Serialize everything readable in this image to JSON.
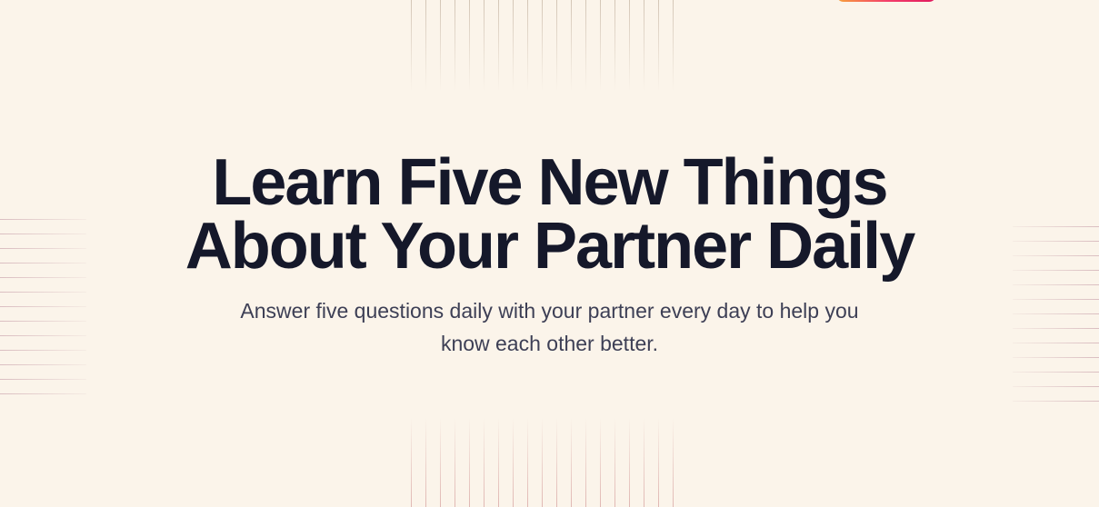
{
  "hero": {
    "title": "Learn Five New Things About Your Partner Daily",
    "subtitle": "Answer five questions daily with your partner every day to help you know each other better."
  },
  "colors": {
    "background": "#fbf4ea",
    "heading": "#15182a",
    "body_text": "#3d3f55",
    "accent_gradient": [
      "#f7a23b",
      "#f43f6b",
      "#e0195e"
    ]
  }
}
